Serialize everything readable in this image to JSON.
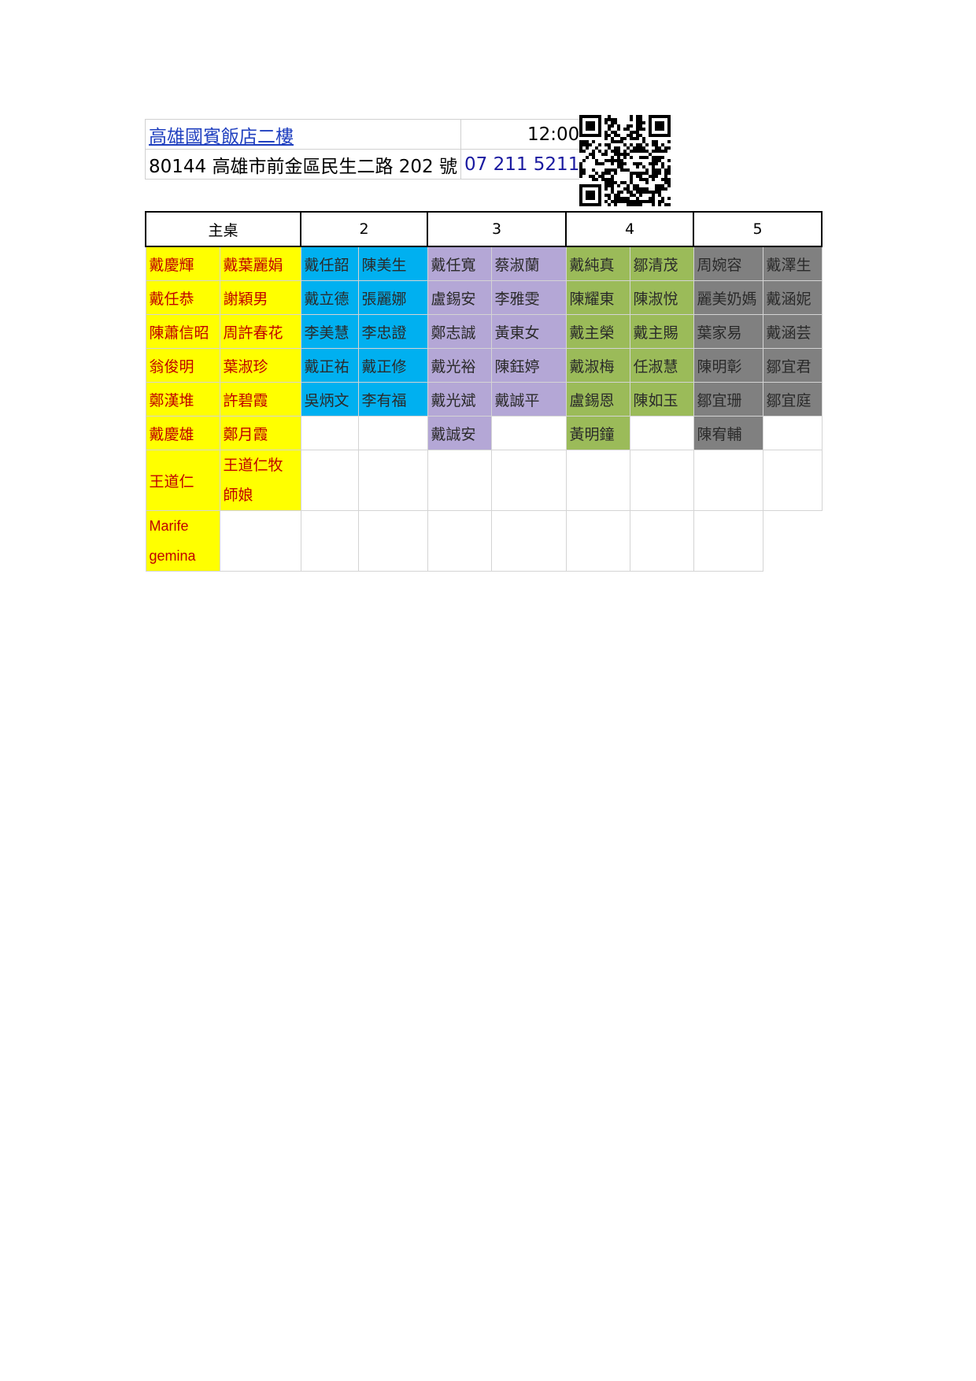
{
  "venue": {
    "name": "高雄國賓飯店二樓",
    "time": "12:00",
    "address": "80144 高雄市前金區民生二路 202 號",
    "phone": "07 211 5211"
  },
  "qr_code": {
    "icon": "qr-code-icon"
  },
  "colors": {
    "main_table": "#ffff00",
    "main_table_text": "#c00000",
    "table2": "#00b0f0",
    "table3": "#b4a7d6",
    "table4": "#9bbb59",
    "table5": "#808080"
  },
  "seating": {
    "headers": [
      "主桌",
      "2",
      "3",
      "4",
      "5"
    ],
    "rows": [
      [
        "戴慶輝",
        "戴葉麗娟",
        "戴任韶",
        "陳美生",
        "戴任寬",
        "蔡淑蘭",
        "戴純真",
        "鄒清茂",
        "周婉容",
        "戴澤生"
      ],
      [
        "戴任恭",
        "謝穎男",
        "戴立德",
        "張麗娜",
        "盧錫安",
        "李雅雯",
        "陳耀東",
        "陳淑悅",
        "麗美奶媽",
        "戴涵妮"
      ],
      [
        "陳蕭信昭",
        "周許春花",
        "李美慧",
        "李忠證",
        "鄭志誠",
        "黃東女",
        "戴主榮",
        "戴主賜",
        "葉家易",
        "戴涵芸"
      ],
      [
        "翁俊明",
        "葉淑珍",
        "戴正祐",
        "戴正修",
        "戴光裕",
        "陳鈺婷",
        "戴淑梅",
        "任淑慧",
        "陳明彰",
        "鄒宜君"
      ],
      [
        "鄭漢堆",
        "許碧霞",
        "吳炳文",
        "李有福",
        "戴光斌",
        "戴誠平",
        "盧錫恩",
        "陳如玉",
        "鄒宜珊",
        "鄒宜庭"
      ],
      [
        "戴慶雄",
        "鄭月霞",
        "",
        "",
        "戴誠安",
        "",
        "黃明鐘",
        "",
        "陳宥輔",
        ""
      ],
      [
        "王道仁",
        "王道仁牧師娘",
        "",
        "",
        "",
        "",
        "",
        "",
        "",
        ""
      ],
      [
        "Marife gemina",
        "",
        "",
        "",
        "",
        "",
        "",
        "",
        "",
        ""
      ]
    ]
  }
}
